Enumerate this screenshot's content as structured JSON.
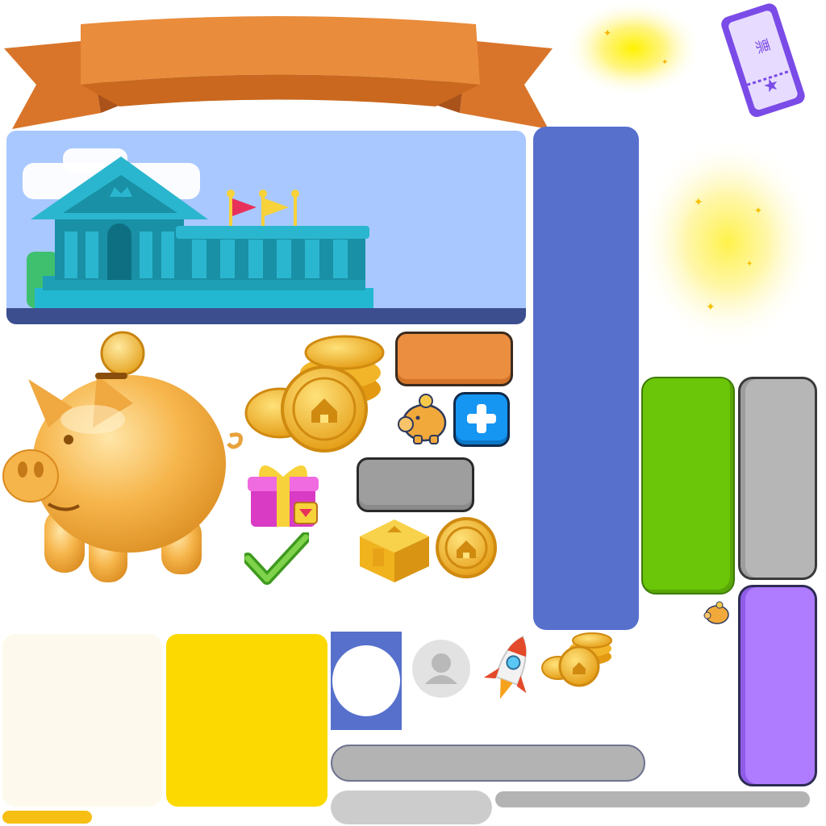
{
  "atlas": {
    "ribbon_color": "#E98C3C",
    "ribbon_dark": "#C9681E",
    "ticket": {
      "glyph": "票",
      "color": "#8B5CF6"
    },
    "bank_scene": {
      "sky": "#A9C8FF",
      "ground": "#3D4E8F",
      "building": "#1E9FB5",
      "roof": "#2BB6CF",
      "flag_red": "#E8315A",
      "flag_yellow": "#F7D23A"
    },
    "colors": {
      "blue_panel": "#5670CC",
      "green_panel": "#6BC508",
      "gray_panel": "#B6B6B6",
      "purple_panel": "#B07CFF",
      "orange_button": "#EB8E40",
      "gray_button": "#9E9E9E",
      "plus_button": "#1596F2",
      "cream_card": "#FDF9EC",
      "yellow_card": "#FCD900",
      "avatar_frame": "#5670CC",
      "progress_gold": "#F7BE14"
    },
    "icons": [
      "ribbon-banner-icon",
      "sparkle-glow-icon",
      "ticket-icon",
      "bank-building-icon",
      "piggy-bank-icon",
      "coin-stack-icon",
      "small-piggy-icon",
      "plus-icon",
      "gift-box-icon",
      "checkmark-icon",
      "treasure-chest-icon",
      "gold-coin-icon",
      "avatar-placeholder-icon",
      "rocket-icon",
      "small-coin-stack-icon",
      "tiny-piggy-icon"
    ]
  }
}
